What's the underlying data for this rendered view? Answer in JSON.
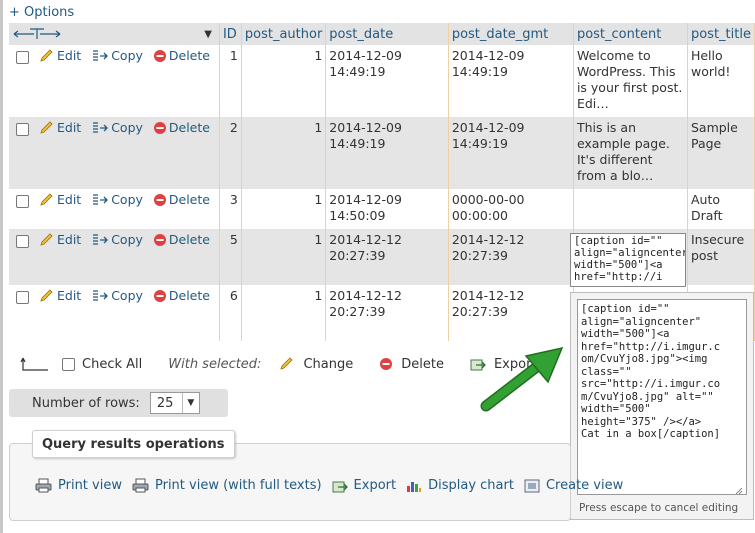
{
  "options_label": "+ Options",
  "columns": [
    "ID",
    "post_author",
    "post_date",
    "post_date_gmt",
    "post_content",
    "post_title"
  ],
  "actions": {
    "edit": "Edit",
    "copy": "Copy",
    "delete": "Delete"
  },
  "rows": [
    {
      "id": "1",
      "post_author": "1",
      "post_date": "2014-12-09 14:49:19",
      "post_date_gmt": "2014-12-09 14:49:19",
      "post_content": "Welcome to WordPress. This is your first post. Edi…",
      "post_title": "Hello world!"
    },
    {
      "id": "2",
      "post_author": "1",
      "post_date": "2014-12-09 14:49:19",
      "post_date_gmt": "2014-12-09 14:49:19",
      "post_content": "This is an example page. It's different from a blo…",
      "post_title": "Sample Page"
    },
    {
      "id": "3",
      "post_author": "1",
      "post_date": "2014-12-09 14:50:09",
      "post_date_gmt": "0000-00-00 00:00:00",
      "post_content": "",
      "post_title": "Auto Draft"
    },
    {
      "id": "5",
      "post_author": "1",
      "post_date": "2014-12-12 20:27:39",
      "post_date_gmt": "2014-12-12 20:27:39",
      "post_content": "[caption id=\"\" align=\"aligncenter\" width=\"500\"]<a href=\"http://i",
      "post_title": "Insecure post"
    },
    {
      "id": "6",
      "post_author": "1",
      "post_date": "2014-12-12 20:27:39",
      "post_date_gmt": "2014-12-12 20:27:39",
      "post_content": "",
      "post_title": ""
    }
  ],
  "editor": {
    "content": "[caption id=\"\"\nalign=\"aligncenter\"\nwidth=\"500\"]<a\nhref=\"http://i.imgur.c\nom/CvuYjo8.jpg\"><img\nclass=\"\"\nsrc=\"http://i.imgur.co\nm/CvuYjo8.jpg\" alt=\"\"\nwidth=\"500\"\nheight=\"375\" /></a>\nCat in a box[/caption]",
    "hint": "Press escape to cancel editing"
  },
  "bulk": {
    "check_all": "Check All",
    "with_selected": "With selected:",
    "change": "Change",
    "delete": "Delete",
    "export": "Export"
  },
  "rows_control": {
    "label": "Number of rows:",
    "value": "25"
  },
  "query_ops": {
    "legend": "Query results operations",
    "links": [
      "Print view",
      "Print view (with full texts)",
      "Export",
      "Display chart",
      "Create view"
    ]
  },
  "colors": {
    "link": "#235a81",
    "header_bg": "#e3e3e3",
    "row_alt": "#e5e5e5",
    "arrow": "#2e8b2e"
  }
}
